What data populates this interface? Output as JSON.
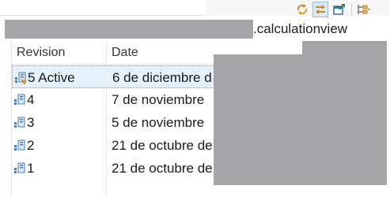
{
  "toolbar": {
    "icons": [
      "sync-icon",
      "link-with-editor-icon",
      "open-compare-icon",
      "collapse-menu-icon"
    ]
  },
  "file": {
    "name_suffix": ".calculationview"
  },
  "table": {
    "headers": {
      "revision": "Revision",
      "date": "Date"
    },
    "rows": [
      {
        "revision": "5 Active",
        "date": "6 de diciembre d",
        "selected": true
      },
      {
        "revision": "4",
        "date": "7 de noviembre"
      },
      {
        "revision": "3",
        "date": "5 de noviembre"
      },
      {
        "revision": "2",
        "date": "21 de octubre de"
      },
      {
        "revision": "1",
        "date": "21 de octubre de"
      }
    ]
  },
  "colors": {
    "selection_bg": "#e5f1fb",
    "redaction": "#a5a5a7"
  }
}
